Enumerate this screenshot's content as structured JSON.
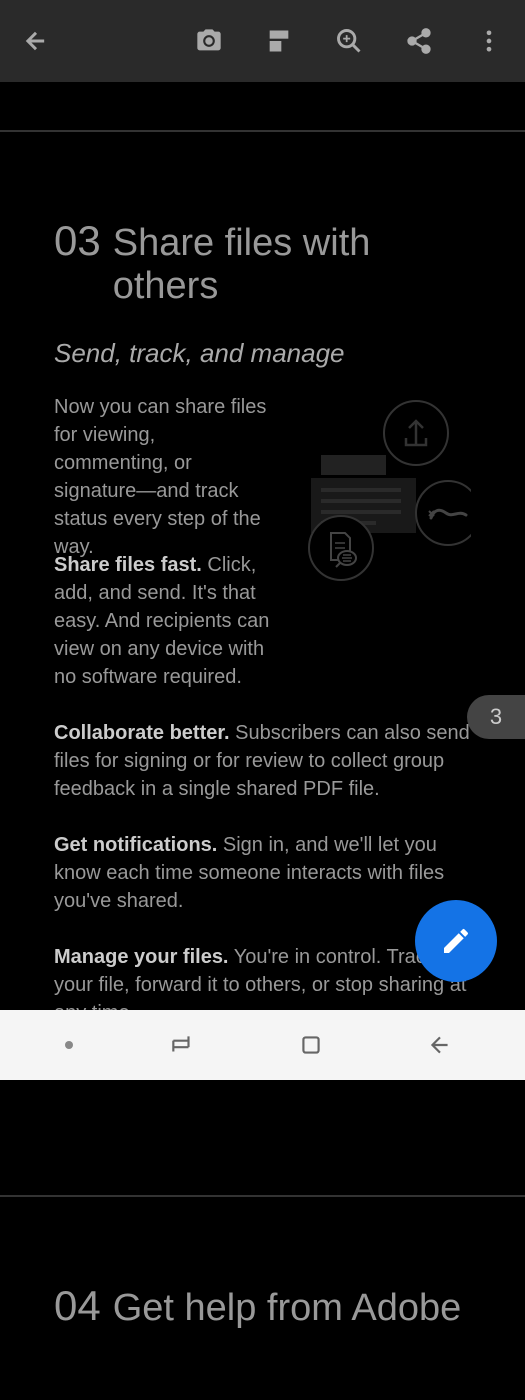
{
  "section3": {
    "number": "03",
    "title": "Share files with others",
    "subtitle": "Send, track, and manage",
    "intro": "Now you can share files for viewing, commenting, or signature—and track status every step of the way.",
    "features": [
      {
        "bold": "Share files fast.",
        "text": " Click, add, and send. It's that easy. And recipients can view on any device with no software required."
      },
      {
        "bold": "Collaborate better.",
        "text": " Subscribers can also send files for signing or for review to collect group feedback in a single shared PDF file."
      },
      {
        "bold": "Get notifications.",
        "text": " Sign in, and we'll let you know each time someone interacts with files you've shared."
      },
      {
        "bold": "Manage your files.",
        "text": " You're in control. Track your file, forward it to others, or stop sharing at any time."
      }
    ]
  },
  "section4": {
    "number": "04",
    "title": "Get help from Adobe"
  },
  "pageIndicator": "3"
}
